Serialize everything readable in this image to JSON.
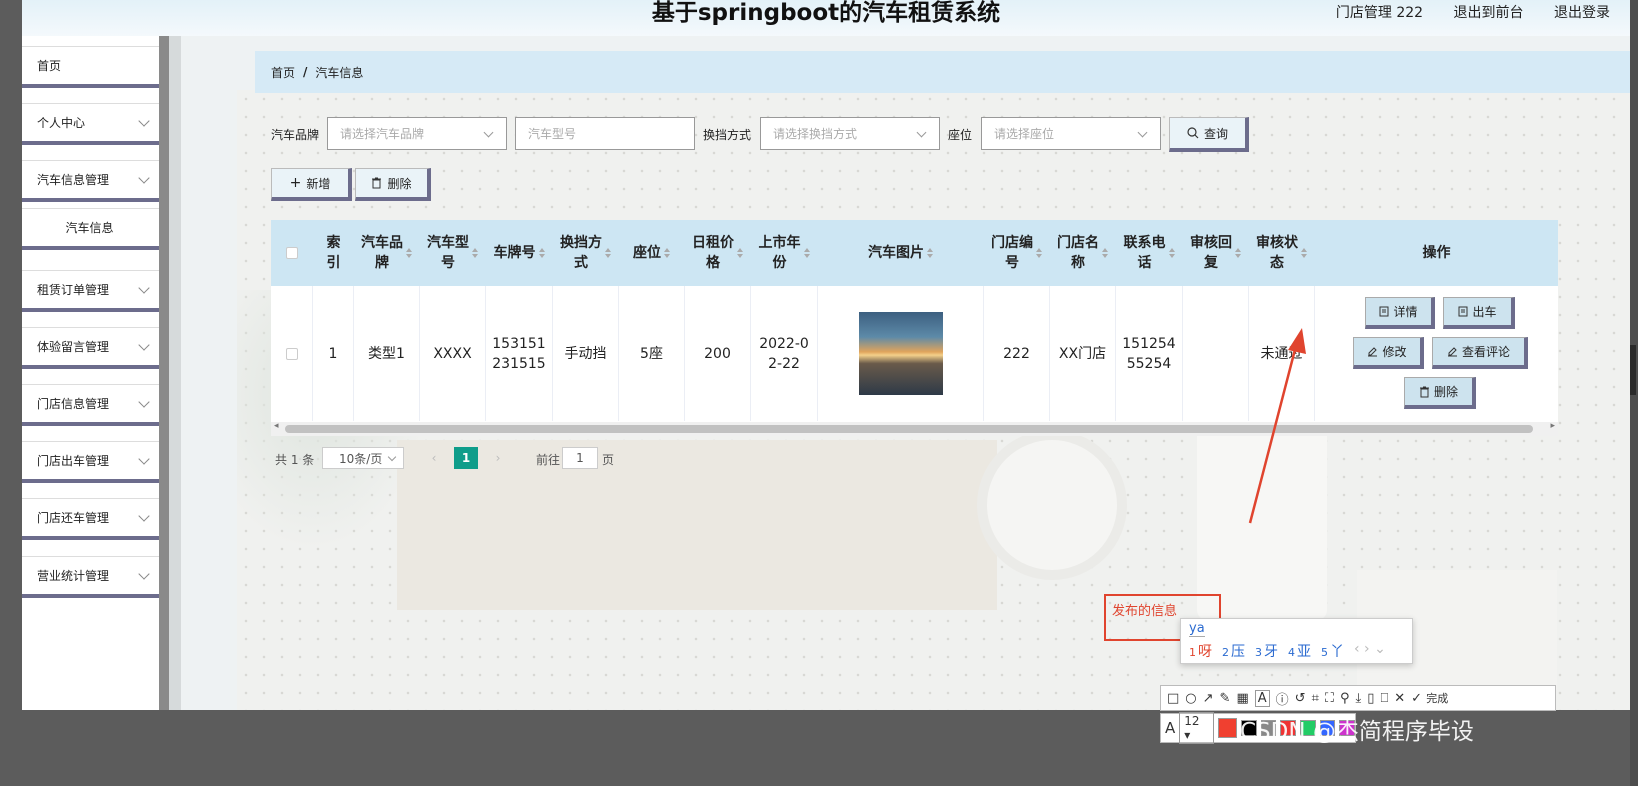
{
  "header": {
    "title": "基于springboot的汽车租赁系统",
    "links": [
      "门店管理 222",
      "退出到前台",
      "退出登录"
    ]
  },
  "sidebar": {
    "items": [
      {
        "label": "首页",
        "has_submenu": false
      },
      {
        "label": "个人中心",
        "has_submenu": true
      },
      {
        "label": "汽车信息管理",
        "has_submenu": true
      },
      {
        "label": "汽车信息",
        "has_submenu": false,
        "is_child": true
      },
      {
        "label": "租赁订单管理",
        "has_submenu": true
      },
      {
        "label": "体验留言管理",
        "has_submenu": true
      },
      {
        "label": "门店信息管理",
        "has_submenu": true
      },
      {
        "label": "门店出车管理",
        "has_submenu": true
      },
      {
        "label": "门店还车管理",
        "has_submenu": true
      },
      {
        "label": "营业统计管理",
        "has_submenu": true
      }
    ]
  },
  "breadcrumb": {
    "home": "首页",
    "separator": "/",
    "current": "汽车信息"
  },
  "filters": {
    "brand_label": "汽车品牌",
    "brand_placeholder": "请选择汽车品牌",
    "model_placeholder": "汽车型号",
    "transmission_label": "换挡方式",
    "transmission_placeholder": "请选择换挡方式",
    "seats_label": "座位",
    "seats_placeholder": "请选择座位",
    "search_button": "查询"
  },
  "toolbar": {
    "add_label": "新增",
    "delete_label": "删除"
  },
  "table": {
    "columns": [
      {
        "label": "索\n引",
        "sortable": false
      },
      {
        "label": "汽车品\n牌",
        "sortable": true
      },
      {
        "label": "汽车型\n号",
        "sortable": true
      },
      {
        "label": "车牌号",
        "sortable": true
      },
      {
        "label": "换挡方\n式",
        "sortable": true
      },
      {
        "label": "座位",
        "sortable": true
      },
      {
        "label": "日租价\n格",
        "sortable": true
      },
      {
        "label": "上市年\n份",
        "sortable": true
      },
      {
        "label": "汽车图片",
        "sortable": true
      },
      {
        "label": "门店编\n号",
        "sortable": true
      },
      {
        "label": "门店名\n称",
        "sortable": true
      },
      {
        "label": "联系电\n话",
        "sortable": true
      },
      {
        "label": "审核回\n复",
        "sortable": true
      },
      {
        "label": "审核状\n态",
        "sortable": true
      },
      {
        "label": "操作",
        "sortable": false
      }
    ],
    "rows": [
      {
        "index": "1",
        "brand": "类型1",
        "model": "XXXX",
        "plate": "153151\n231515",
        "transmission": "手动挡",
        "seats": "5座",
        "daily_price": "200",
        "release_year": "2022-0\n2-22",
        "image_alt": "汽车图片",
        "store_no": "222",
        "store_name": "XX门店",
        "phone": "151254\n55254",
        "review_reply": "",
        "review_status": "未通过",
        "actions": [
          "详情",
          "出车",
          "修改",
          "查看评论",
          "删除"
        ]
      }
    ]
  },
  "pagination": {
    "total": "共 1 条",
    "page_size": "10条/页",
    "current_page": "1",
    "goto_prefix": "前往",
    "goto_value": "1",
    "goto_suffix": "页"
  },
  "overlay": {
    "annotation_text": "发布的信息",
    "ime_composition": "ya",
    "ime_candidates": [
      {
        "num": "1",
        "text": "呀"
      },
      {
        "num": "2",
        "text": "压"
      },
      {
        "num": "3",
        "text": "牙"
      },
      {
        "num": "4",
        "text": "亚"
      },
      {
        "num": "5",
        "text": "丫"
      }
    ],
    "toolbar_done": "完成",
    "font_size": "12",
    "watermark": "CSDN @杰简程序毕设"
  },
  "colors": {
    "accent": "#0f9d8a",
    "header_bg": "#e3f1f8",
    "table_header_bg": "#cde6f3",
    "annotation_red": "#e0442e",
    "button_shadow": "#6c6c8c"
  }
}
